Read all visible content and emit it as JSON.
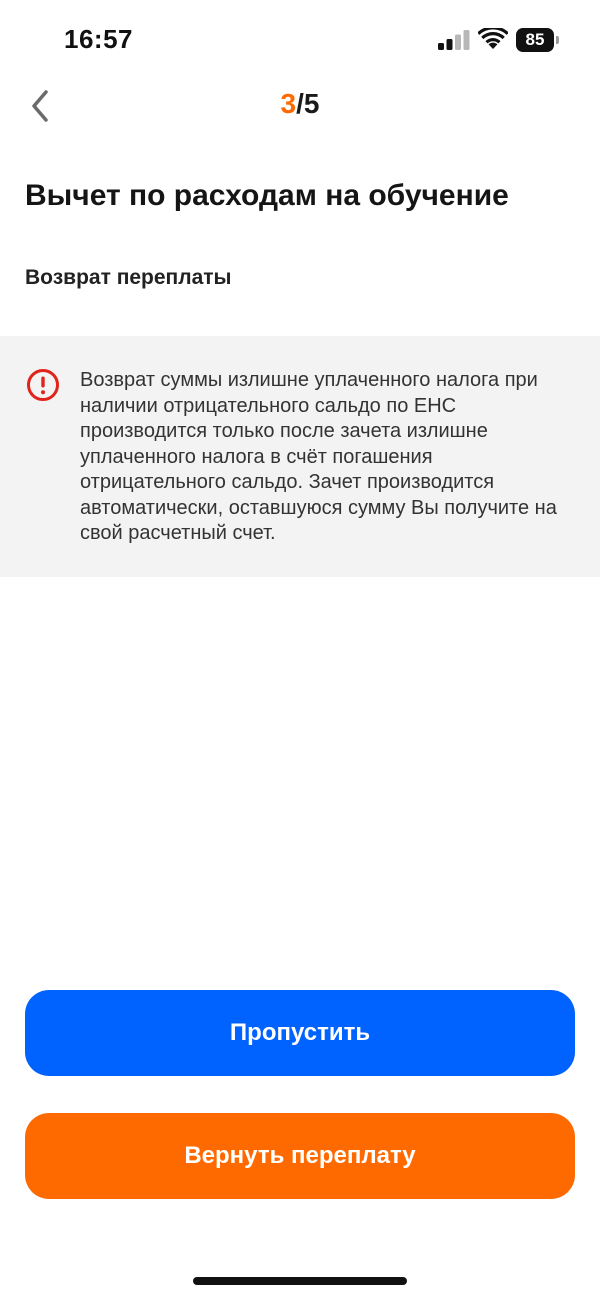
{
  "status_bar": {
    "time": "16:57",
    "battery_level": "85",
    "icons": [
      "cellular-signal-icon",
      "wifi-icon",
      "battery-icon"
    ]
  },
  "header": {
    "step_current": "3",
    "step_separator": "/",
    "step_total": "5",
    "back_icon": "chevron-left-icon"
  },
  "main": {
    "title": "Вычет по расходам на обучение",
    "subtitle": "Возврат переплаты",
    "info": {
      "icon": "alert-circle-icon",
      "text": "Возврат суммы излишне уплаченного налога при наличии отрицательного сальдо по ЕНС производится только после зачета излишне уплаченного налога в счёт погашения отрицательного сальдо. Зачет производится автоматически, оставшуюся сумму Вы получите на свой расчетный счет."
    }
  },
  "actions": {
    "skip_label": "Пропустить",
    "refund_label": "Вернуть переплату"
  },
  "colors": {
    "accent_orange": "#ff6a00",
    "primary_blue": "#0062ff",
    "alert_red": "#e0241b",
    "info_background": "#f3f3f3"
  }
}
